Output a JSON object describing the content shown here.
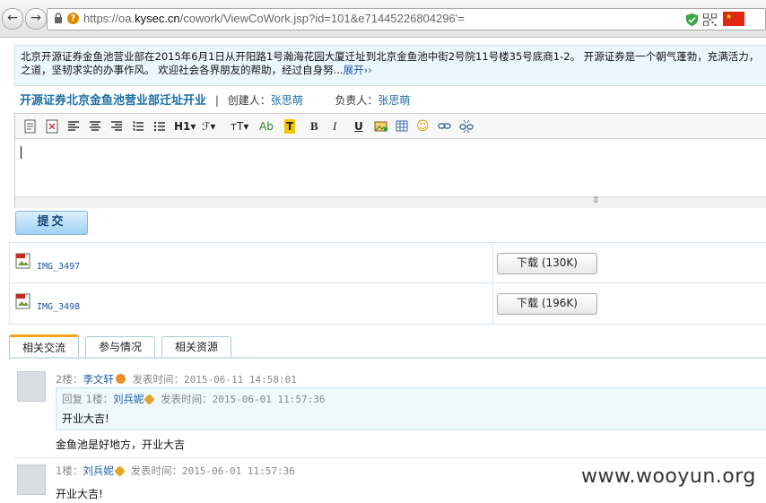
{
  "browser": {
    "url_scheme": "https://oa.",
    "url_host": "kysec.cn",
    "url_path": "/cowork/ViewCoWork.jsp?id=101&e71445226804296'=",
    "back_glyph": "←",
    "forward_glyph": "→",
    "warn_glyph": "?",
    "flag_glyph": "★"
  },
  "notice": {
    "line1": "北京开源证券金鱼池营业部在2015年6月1日从开阳路1号瀚海花园大厦迁址到北京金鱼池中街2号院11号楼35号底商1-2。 开源证券是一个朝气蓬勃，充满活力，",
    "line2": "之道，坚韧求实的办事作风。 欢迎社会各界朋友的帮助，经过自身努...",
    "expand": "展开››"
  },
  "work": {
    "title": "开源证券北京金鱼池营业部迁址开业",
    "separator": "|",
    "creator_label": "创建人：",
    "creator": "张思萌",
    "owner_label": "负责人：",
    "owner": "张思萌"
  },
  "editor": {
    "tools": {
      "heading": "H1▾",
      "font": "ℱ▾",
      "size": "тT▾",
      "color": "Ab",
      "bgcolor": "T",
      "bold": "B",
      "italic": "I",
      "underline": "U",
      "emoji": "☺"
    },
    "resize_glyph": "⇳"
  },
  "submit_label": "提交",
  "attachments": [
    {
      "name": "IMG_3497",
      "download_label": "下载  (130K)"
    },
    {
      "name": "IMG_3498",
      "download_label": "下载  (196K)"
    }
  ],
  "tabs": [
    {
      "label": "相关交流",
      "active": true
    },
    {
      "label": "参与情况",
      "active": false
    },
    {
      "label": "相关资源",
      "active": false
    }
  ],
  "comments": [
    {
      "floor": "2楼：",
      "user": "李文轩",
      "time_label": "发表时间：",
      "time": "2015-06-11 14:58:01",
      "reply": {
        "prefix": "回复 1楼：",
        "user": "刘兵妮",
        "time_label": "发表时间：",
        "time": "2015-06-01 11:57:36",
        "text": "开业大吉!"
      },
      "text": "金鱼池是好地方，开业大吉"
    },
    {
      "floor": "1楼：",
      "user": "刘兵妮",
      "time_label": "发表时间：",
      "time": "2015-06-01 11:57:36",
      "text": "开业大吉!"
    }
  ],
  "watermark": "www.wooyun.org"
}
